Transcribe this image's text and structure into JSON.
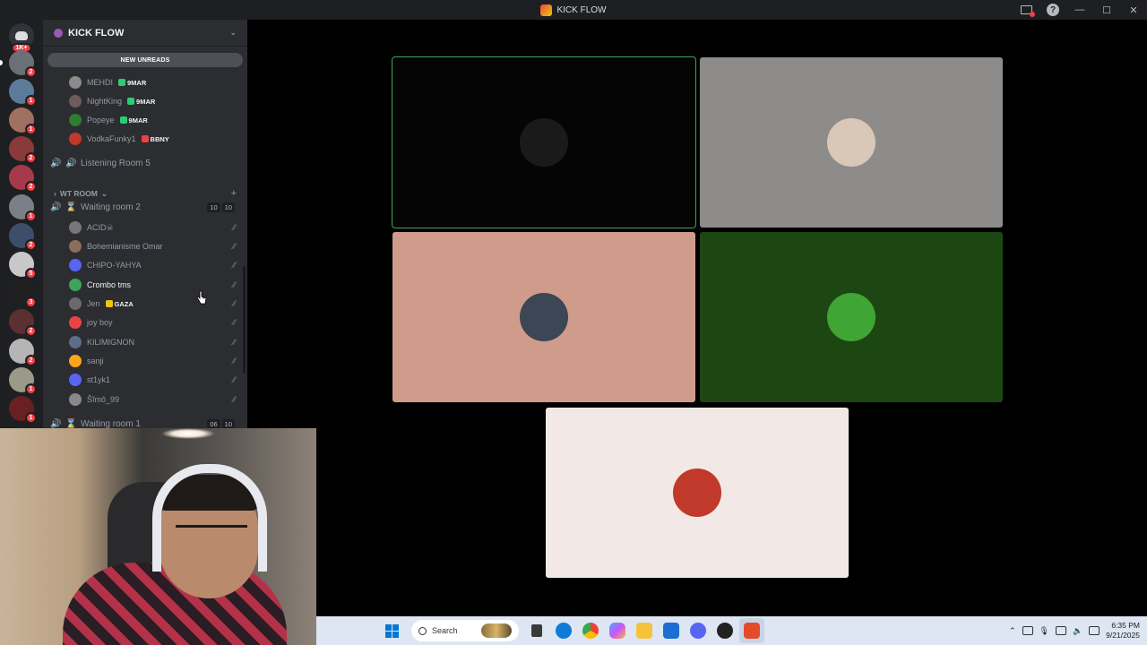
{
  "titlebar": {
    "title": "KICK FLOW"
  },
  "rail": {
    "home_badge": "1K+",
    "servers": [
      {
        "color": "#6b6f76",
        "badge": "2"
      },
      {
        "color": "#5c7a99",
        "badge": "1"
      },
      {
        "color": "#a07060",
        "badge": "1"
      },
      {
        "color": "#8b3a3a",
        "badge": "2"
      },
      {
        "color": "#a63a4a",
        "badge": "2"
      },
      {
        "color": "#7a7f88",
        "badge": "1"
      },
      {
        "color": "#3d4e6b",
        "badge": "2"
      },
      {
        "color": "#c8c8c8",
        "badge": "5"
      },
      {
        "color": "#202020",
        "badge": "3"
      },
      {
        "color": "#5a3030",
        "badge": "2"
      },
      {
        "color": "#b5b5b5",
        "badge": "2"
      },
      {
        "color": "#9a9a8a",
        "badge": "1"
      },
      {
        "color": "#6a2020",
        "badge": "1"
      }
    ]
  },
  "sidebar": {
    "guild_name": "KICK FLOW",
    "new_unreads": "NEW UNREADS",
    "top_users": [
      {
        "name": "MEHDI",
        "tag": "9MAR",
        "tag_color": "#2ecc71",
        "avatar": "#8b8b8b"
      },
      {
        "name": "NightKing",
        "tag": "9MAR",
        "tag_color": "#2ecc71",
        "avatar": "#6e5b5b"
      },
      {
        "name": "Popeye",
        "tag": "9MAR",
        "tag_color": "#2ecc71",
        "avatar": "#2e7d32"
      },
      {
        "name": "VodkaFunky1",
        "tag": "BBNY",
        "tag_color": "#f23f43",
        "avatar": "#c0392b"
      }
    ],
    "listening_room": "Listening Room 5",
    "category": "WT ROOM",
    "waiting_room_2": {
      "name": "Waiting room 2",
      "count_a": "10",
      "count_b": "10"
    },
    "room_users": [
      {
        "name": "ACID☠",
        "avatar": "#777777",
        "active": false
      },
      {
        "name": "Bohemianisme Omar",
        "avatar": "#8a6d5a",
        "active": false
      },
      {
        "name": "CHIPO-YAHYA",
        "avatar": "#5865f2",
        "active": false
      },
      {
        "name": "Crombo tms",
        "avatar": "#3ba55c",
        "active": true
      },
      {
        "name": "Jen",
        "tag": "GAZA",
        "avatar": "#6a6a6a",
        "active": false
      },
      {
        "name": "joy boy",
        "avatar": "#ed4245",
        "active": false
      },
      {
        "name": "KILIMIGNON",
        "avatar": "#5b6e8a",
        "active": false
      },
      {
        "name": "sanji",
        "avatar": "#faa61a",
        "active": false
      },
      {
        "name": "st1yk1",
        "avatar": "#5865f2",
        "active": false
      },
      {
        "name": "Šĩmô_99",
        "avatar": "#888888",
        "active": false
      }
    ],
    "waiting_room_1": {
      "name": "Waiting room 1",
      "count_a": "06",
      "count_b": "10"
    }
  },
  "stage": {
    "tiles": [
      {
        "bg": "#050505",
        "avatar": "#1a1a1a",
        "speaking": true
      },
      {
        "bg": "#8e8c8a",
        "avatar": "#d9c7b8",
        "speaking": false
      },
      {
        "bg": "#cf9c8b",
        "avatar": "#3c4654",
        "speaking": false
      },
      {
        "bg": "#1d4712",
        "avatar": "#3fa535",
        "speaking": false
      },
      {
        "bg": "#f2e8e6",
        "avatar": "#c0392b",
        "speaking": false
      }
    ]
  },
  "taskbar": {
    "search_placeholder": "Search",
    "time": "6:35 PM",
    "date": "9/21/2025"
  }
}
